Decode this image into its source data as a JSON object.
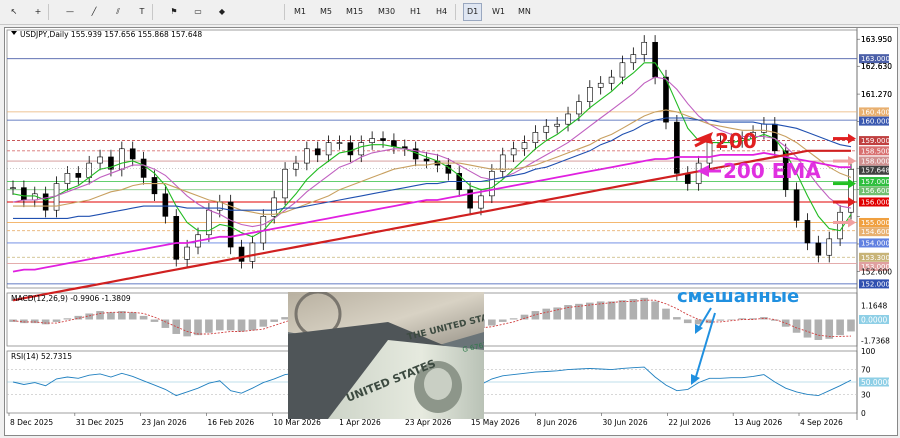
{
  "toolbar": {
    "tools": [
      "cursor-icon",
      "crosshair-icon",
      "hline-icon",
      "trendline-icon",
      "channel-icon",
      "text-icon",
      "label-icon",
      "rect-icon",
      "shapes-icon"
    ],
    "timeframes": [
      "M1",
      "M5",
      "M15",
      "M30",
      "H1",
      "H4",
      "D1",
      "W1",
      "MN"
    ],
    "active_timeframe": "D1"
  },
  "chart_data": [
    {
      "type": "line",
      "title": "USDJPY,Daily  155.939 157.656 155.868 157.648",
      "ylim": [
        151.8,
        164.4
      ],
      "price_ticks": [
        "163.950",
        "162.630",
        "161.270",
        "159.930",
        "157.648",
        "156.610",
        "155.290",
        "153.950",
        "152.600"
      ],
      "level_tags": [
        {
          "text": "163.000",
          "value": 163.0,
          "color": "#4b5fa8"
        },
        {
          "text": "160.400",
          "value": 160.4,
          "color": "#e8b070"
        },
        {
          "text": "160.000",
          "value": 160.0,
          "color": "#3a58b0"
        },
        {
          "text": "159.000",
          "value": 159.0,
          "color": "#c04040"
        },
        {
          "text": "158.500",
          "value": 158.5,
          "color": "#d87070"
        },
        {
          "text": "158.000",
          "value": 158.0,
          "color": "#d09090"
        },
        {
          "text": "157.648",
          "value": 157.648,
          "color": "#404040"
        },
        {
          "text": "157.000",
          "value": 157.0,
          "color": "#2fbf3f"
        },
        {
          "text": "156.600",
          "value": 156.6,
          "color": "#70c070"
        },
        {
          "text": "156.000",
          "value": 156.0,
          "color": "#e00000"
        },
        {
          "text": "155.000",
          "value": 155.0,
          "color": "#f0a040"
        },
        {
          "text": "154.600",
          "value": 154.6,
          "color": "#e8b070"
        },
        {
          "text": "154.000",
          "value": 154.0,
          "color": "#6080e0"
        },
        {
          "text": "153.300",
          "value": 153.3,
          "color": "#c8b478"
        },
        {
          "text": "153.000",
          "value": 153.0,
          "color": "#e0a0a0"
        },
        {
          "text": "152.000",
          "value": 152.0,
          "color": "#3050b0"
        }
      ],
      "series": [
        {
          "name": "",
          "color": "#000000",
          "kind": "price",
          "values": [
            156.7,
            156.1,
            156.4,
            155.6,
            156.9,
            157.4,
            157.2,
            157.9,
            158.2,
            157.6,
            158.6,
            158.1,
            157.2,
            156.4,
            155.3,
            153.2,
            153.8,
            154.4,
            155.6,
            156.0,
            153.8,
            153.1,
            154.0,
            155.3,
            156.2,
            157.6,
            157.9,
            158.6,
            158.3,
            158.9,
            158.9,
            158.3,
            158.9,
            159.1,
            159.0,
            158.7,
            158.6,
            158.1,
            158.0,
            157.8,
            157.4,
            156.6,
            155.7,
            156.3,
            157.5,
            158.3,
            158.6,
            158.9,
            159.4,
            159.7,
            159.8,
            160.3,
            160.9,
            161.6,
            161.8,
            162.1,
            162.8,
            163.2,
            163.8,
            162.1,
            159.9,
            157.4,
            156.9,
            157.9,
            158.9,
            158.9,
            159.0,
            159.1,
            159.4,
            159.8,
            158.5,
            156.6,
            155.1,
            154.0,
            153.4,
            154.2,
            155.5,
            157.6
          ]
        },
        {
          "name": "",
          "color": "#22bb22",
          "kind": "ma",
          "values": [
            156.4,
            156.3,
            156.3,
            156.1,
            156.3,
            156.6,
            156.8,
            157.2,
            157.6,
            157.7,
            157.9,
            158.0,
            157.8,
            157.4,
            156.8,
            155.8,
            155.0,
            154.6,
            154.6,
            154.9,
            154.8,
            154.5,
            154.3,
            154.6,
            155.2,
            155.8,
            156.4,
            157.1,
            157.6,
            158.0,
            158.4,
            158.5,
            158.7,
            158.8,
            158.8,
            158.7,
            158.6,
            158.4,
            158.2,
            158.0,
            157.7,
            157.3,
            156.8,
            156.6,
            156.7,
            157.1,
            157.6,
            158.1,
            158.6,
            159.0,
            159.3,
            159.7,
            160.1,
            160.6,
            161.0,
            161.4,
            161.9,
            162.3,
            162.8,
            162.8,
            162.0,
            160.8,
            159.6,
            159.0,
            158.9,
            158.9,
            158.9,
            159.0,
            159.1,
            159.3,
            159.1,
            158.4,
            157.4,
            156.3,
            155.3,
            154.7,
            154.6,
            155.4
          ]
        },
        {
          "name": "",
          "color": "#c060c0",
          "kind": "ma",
          "values": [
            156.0,
            156.1,
            156.1,
            156.2,
            156.3,
            156.5,
            156.7,
            156.9,
            157.2,
            157.4,
            157.6,
            157.8,
            157.8,
            157.6,
            157.3,
            156.8,
            156.3,
            155.9,
            155.6,
            155.4,
            155.1,
            154.9,
            154.8,
            154.9,
            155.2,
            155.6,
            156.0,
            156.5,
            156.9,
            157.3,
            157.7,
            157.9,
            158.2,
            158.4,
            158.5,
            158.6,
            158.6,
            158.5,
            158.4,
            158.3,
            158.1,
            157.8,
            157.5,
            157.2,
            157.1,
            157.2,
            157.4,
            157.7,
            158.0,
            158.3,
            158.6,
            158.9,
            159.3,
            159.7,
            160.1,
            160.5,
            160.9,
            161.3,
            161.8,
            162.1,
            162.0,
            161.5,
            160.8,
            160.2,
            159.8,
            159.5,
            159.3,
            159.2,
            159.2,
            159.2,
            159.1,
            158.7,
            158.2,
            157.5,
            156.8,
            156.2,
            155.8,
            155.7
          ]
        },
        {
          "name": "",
          "color": "#c8a060",
          "kind": "ma",
          "values": [
            155.8,
            155.8,
            155.8,
            155.8,
            155.8,
            155.9,
            156.0,
            156.1,
            156.3,
            156.5,
            156.6,
            156.8,
            156.9,
            156.9,
            156.9,
            156.7,
            156.5,
            156.3,
            156.1,
            156.0,
            155.8,
            155.6,
            155.5,
            155.4,
            155.4,
            155.5,
            155.7,
            155.9,
            156.1,
            156.3,
            156.6,
            156.8,
            157.0,
            157.2,
            157.4,
            157.6,
            157.7,
            157.8,
            157.8,
            157.9,
            157.9,
            157.9,
            157.8,
            157.7,
            157.6,
            157.6,
            157.6,
            157.7,
            157.8,
            158.0,
            158.2,
            158.4,
            158.6,
            158.8,
            159.1,
            159.3,
            159.6,
            159.9,
            160.2,
            160.4,
            160.5,
            160.4,
            160.2,
            160.0,
            159.8,
            159.7,
            159.6,
            159.5,
            159.5,
            159.5,
            159.4,
            159.2,
            158.9,
            158.5,
            158.1,
            157.7,
            157.4,
            157.2
          ]
        },
        {
          "name": "",
          "color": "#2050b0",
          "kind": "ma",
          "values": [
            155.2,
            155.2,
            155.2,
            155.2,
            155.2,
            155.2,
            155.3,
            155.3,
            155.4,
            155.5,
            155.6,
            155.7,
            155.8,
            155.8,
            155.8,
            155.8,
            155.7,
            155.7,
            155.7,
            155.7,
            155.6,
            155.6,
            155.6,
            155.6,
            155.6,
            155.7,
            155.7,
            155.8,
            155.9,
            156.0,
            156.1,
            156.2,
            156.3,
            156.4,
            156.5,
            156.6,
            156.7,
            156.8,
            156.9,
            156.9,
            157.0,
            157.0,
            157.0,
            157.0,
            157.1,
            157.2,
            157.3,
            157.4,
            157.6,
            157.7,
            157.9,
            158.1,
            158.3,
            158.5,
            158.8,
            159.0,
            159.3,
            159.5,
            159.8,
            160.0,
            160.1,
            160.1,
            160.1,
            160.0,
            160.0,
            159.9,
            159.9,
            159.9,
            159.9,
            159.8,
            159.8,
            159.7,
            159.6,
            159.4,
            159.2,
            159.0,
            158.8,
            158.7
          ]
        },
        {
          "name": "",
          "color": "#e020e0",
          "kind": "ma",
          "values": [
            152.6,
            152.7,
            152.7,
            152.8,
            152.9,
            153.0,
            153.1,
            153.2,
            153.3,
            153.4,
            153.5,
            153.6,
            153.7,
            153.8,
            153.9,
            154.0,
            154.0,
            154.1,
            154.2,
            154.3,
            154.3,
            154.4,
            154.5,
            154.6,
            154.7,
            154.8,
            154.9,
            155.0,
            155.1,
            155.2,
            155.3,
            155.4,
            155.5,
            155.6,
            155.7,
            155.8,
            155.9,
            156.0,
            156.1,
            156.1,
            156.2,
            156.3,
            156.4,
            156.5,
            156.6,
            156.7,
            156.8,
            156.9,
            157.0,
            157.1,
            157.2,
            157.3,
            157.4,
            157.5,
            157.6,
            157.7,
            157.8,
            157.9,
            158.0,
            158.1,
            158.1,
            158.2,
            158.2,
            158.2,
            158.2,
            158.3,
            158.3,
            158.3,
            158.3,
            158.4,
            158.3,
            158.2,
            158.1,
            158.0,
            157.9,
            157.8,
            157.7,
            157.7
          ]
        },
        {
          "name": "",
          "color": "#d02020",
          "kind": "ma200",
          "values": [
            151.2,
            151.3,
            151.4,
            151.5,
            151.6,
            151.7,
            151.8,
            151.9,
            152.0,
            152.1,
            152.2,
            152.3,
            152.4,
            152.5,
            152.6,
            152.7,
            152.8,
            152.9,
            153.0,
            153.1,
            153.2,
            153.3,
            153.4,
            153.5,
            153.6,
            153.7,
            153.8,
            153.9,
            154.0,
            154.1,
            154.2,
            154.3,
            154.4,
            154.5,
            154.6,
            154.7,
            154.8,
            154.9,
            155.0,
            155.1,
            155.2,
            155.3,
            155.4,
            155.5,
            155.6,
            155.7,
            155.8,
            155.9,
            156.0,
            156.1,
            156.2,
            156.3,
            156.4,
            156.5,
            156.6,
            156.7,
            156.8,
            156.9,
            157.0,
            157.1,
            157.2,
            157.3,
            157.4,
            157.5,
            157.6,
            157.7,
            157.8,
            157.9,
            158.0,
            158.1,
            158.2,
            158.3,
            158.4,
            158.5,
            158.5,
            158.5,
            158.5,
            158.5
          ]
        }
      ]
    },
    {
      "type": "bar",
      "title": "MACD(12,26,9) -0.9906 -1.3809",
      "ylim": [
        -2.2,
        2.2
      ],
      "ticks": [
        "1.1648",
        "0.0000",
        "-1.7368"
      ],
      "series": [
        {
          "name": "",
          "color": "#a0a0a0",
          "kind": "hist",
          "values": [
            -0.2,
            -0.3,
            -0.3,
            -0.4,
            -0.2,
            0.1,
            0.3,
            0.5,
            0.7,
            0.6,
            0.7,
            0.6,
            0.3,
            -0.2,
            -0.7,
            -1.2,
            -1.4,
            -1.3,
            -1.1,
            -0.9,
            -0.9,
            -1.0,
            -0.9,
            -0.6,
            -0.2,
            0.2,
            0.5,
            0.8,
            0.9,
            1.0,
            1.0,
            0.9,
            0.9,
            0.8,
            0.7,
            0.5,
            0.3,
            0.1,
            -0.1,
            -0.3,
            -0.4,
            -0.6,
            -0.8,
            -0.7,
            -0.5,
            -0.2,
            0.1,
            0.4,
            0.7,
            0.9,
            1.0,
            1.2,
            1.3,
            1.4,
            1.5,
            1.5,
            1.6,
            1.7,
            1.8,
            1.5,
            0.9,
            0.2,
            -0.3,
            -0.4,
            -0.3,
            -0.1,
            0.0,
            0.1,
            0.1,
            0.2,
            -0.1,
            -0.6,
            -1.1,
            -1.5,
            -1.7,
            -1.6,
            -1.3,
            -0.99
          ]
        },
        {
          "name": "",
          "color": "#d04040",
          "kind": "signal",
          "values": [
            -0.1,
            -0.2,
            -0.2,
            -0.3,
            -0.3,
            -0.1,
            0.1,
            0.3,
            0.5,
            0.6,
            0.6,
            0.6,
            0.5,
            0.2,
            -0.2,
            -0.6,
            -1.0,
            -1.2,
            -1.2,
            -1.1,
            -1.0,
            -1.0,
            -0.9,
            -0.8,
            -0.5,
            -0.2,
            0.1,
            0.4,
            0.6,
            0.8,
            0.9,
            0.9,
            0.9,
            0.9,
            0.8,
            0.7,
            0.5,
            0.3,
            0.1,
            -0.1,
            -0.2,
            -0.4,
            -0.6,
            -0.7,
            -0.6,
            -0.4,
            -0.2,
            0.1,
            0.4,
            0.6,
            0.8,
            1.0,
            1.1,
            1.2,
            1.3,
            1.4,
            1.5,
            1.5,
            1.6,
            1.6,
            1.3,
            0.9,
            0.4,
            0.0,
            -0.2,
            -0.2,
            -0.1,
            0.0,
            0.0,
            0.1,
            0.0,
            -0.3,
            -0.7,
            -1.0,
            -1.3,
            -1.4,
            -1.4,
            -1.38
          ]
        }
      ]
    },
    {
      "type": "line",
      "title": "RSI(14) 52.7315",
      "ylim": [
        0,
        100
      ],
      "ticks": [
        "100",
        "70",
        "50.0000",
        "30",
        "0"
      ],
      "series": [
        {
          "name": "",
          "color": "#2080c0",
          "kind": "rsi",
          "values": [
            50,
            46,
            49,
            44,
            55,
            58,
            56,
            61,
            63,
            58,
            64,
            59,
            52,
            45,
            38,
            28,
            34,
            40,
            48,
            52,
            36,
            32,
            40,
            49,
            55,
            62,
            64,
            68,
            64,
            67,
            66,
            61,
            65,
            66,
            64,
            61,
            60,
            56,
            55,
            54,
            50,
            45,
            40,
            46,
            55,
            60,
            62,
            64,
            66,
            67,
            68,
            70,
            71,
            72,
            71,
            70,
            72,
            73,
            74,
            58,
            45,
            36,
            38,
            49,
            56,
            56,
            57,
            57,
            59,
            62,
            50,
            40,
            34,
            30,
            28,
            36,
            44,
            53
          ]
        }
      ]
    }
  ],
  "date_labels": [
    "8 Dec 2025",
    "31 Dec 2025",
    "23 Jan 2026",
    "16 Feb 2026",
    "10 Mar 2026",
    "1 Apr 2026",
    "23 Apr 2026",
    "15 May 2026",
    "8 Jun 2026",
    "30 Jun 2026",
    "22 Jul 2026",
    "13 Aug 2026",
    "4 Sep 2026"
  ],
  "annotations": {
    "ma200_label": "200",
    "ema200_label": "200 EMA",
    "mixed_label": "смешанные"
  },
  "arrow_colors": {
    "red": "#e02020",
    "pink": "#f0a0a0",
    "magenta": "#e030e0",
    "green": "#20c020",
    "blue": "#2090e0"
  }
}
